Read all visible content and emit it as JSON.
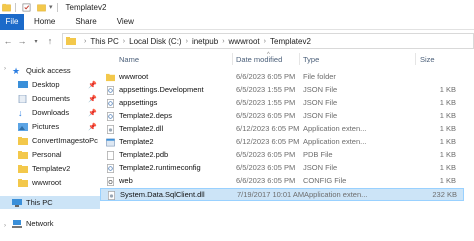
{
  "window": {
    "title": "Templatev2"
  },
  "ribbon": {
    "tabs": [
      "File",
      "Home",
      "Share",
      "View"
    ]
  },
  "address": {
    "crumbs": [
      "This PC",
      "Local Disk (C:)",
      "inetpub",
      "wwwroot",
      "Templatev2"
    ]
  },
  "nav": {
    "quick_access": "Quick access",
    "items": [
      "Desktop",
      "Documents",
      "Downloads",
      "Pictures",
      "ConvertImagestoPc",
      "Personal",
      "Templatev2",
      "wwwroot"
    ],
    "this_pc": "This PC",
    "network": "Network"
  },
  "columns": {
    "name": "Name",
    "date": "Date modified",
    "type": "Type",
    "size": "Size"
  },
  "files": [
    {
      "name": "wwwroot",
      "date": "6/6/2023 6:05 PM",
      "type": "File folder",
      "size": ""
    },
    {
      "name": "appsettings.Development",
      "date": "6/5/2023 1:55 PM",
      "type": "JSON File",
      "size": "1 KB"
    },
    {
      "name": "appsettings",
      "date": "6/5/2023 1:55 PM",
      "type": "JSON File",
      "size": "1 KB"
    },
    {
      "name": "Template2.deps",
      "date": "6/5/2023 6:05 PM",
      "type": "JSON File",
      "size": "1 KB"
    },
    {
      "name": "Template2.dll",
      "date": "6/12/2023 6:05 PM",
      "type": "Application exten...",
      "size": "1 KB"
    },
    {
      "name": "Template2",
      "date": "6/12/2023 6:05 PM",
      "type": "Application exten...",
      "size": "1 KB"
    },
    {
      "name": "Template2.pdb",
      "date": "6/5/2023 6:05 PM",
      "type": "PDB File",
      "size": "1 KB"
    },
    {
      "name": "Template2.runtimeconfig",
      "date": "6/5/2023 6:05 PM",
      "type": "JSON File",
      "size": "1 KB"
    },
    {
      "name": "web",
      "date": "6/6/2023 6:05 PM",
      "type": "CONFIG File",
      "size": "1 KB"
    },
    {
      "name": "System.Data.SqlClient.dll",
      "date": "7/19/2017 10:01 AM",
      "type": "Application exten...",
      "size": "232 KB"
    }
  ],
  "colors": {
    "accent": "#1b6ac9",
    "folder": "#f3c84b",
    "selection": "#cce4f7",
    "selection_border": "#99d1ff"
  }
}
